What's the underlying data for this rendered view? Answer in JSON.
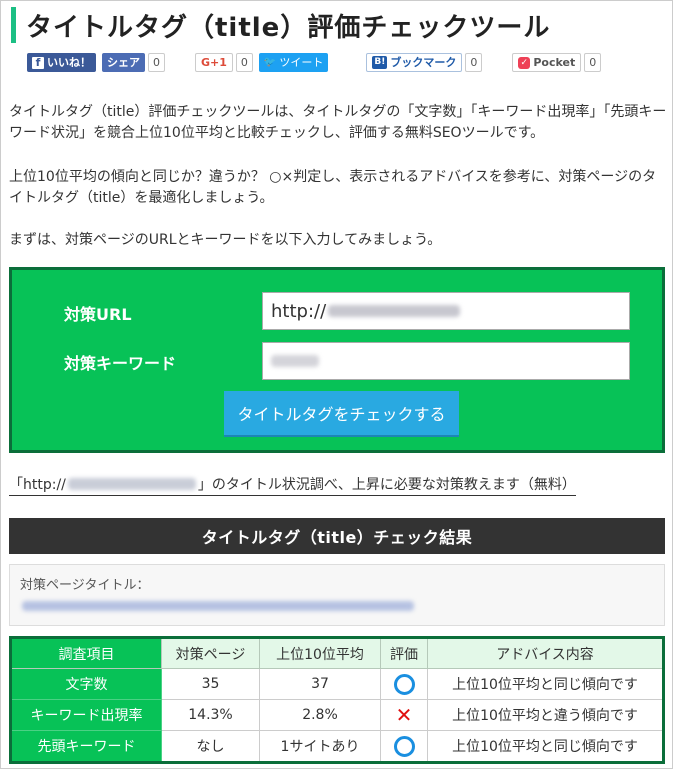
{
  "title": "タイトルタグ（title）評価チェックツール",
  "share": {
    "facebook_like": "いいね！",
    "facebook_share": "シェア",
    "facebook_count": "0",
    "google_plus": "G+1",
    "google_count": "0",
    "twitter": "ツイート",
    "hatena": "ブックマーク",
    "hatena_count": "0",
    "pocket": "Pocket",
    "pocket_count": "0"
  },
  "intro": {
    "p1": "タイトルタグ（title）評価チェックツールは、タイトルタグの「文字数」「キーワード出現率」「先頭キーワード状況」を競合上位10位平均と比較チェックし、評価する無料SEOツールです。",
    "p2": "上位10位平均の傾向と同じか？違うか？ ○×判定し、表示されるアドバイスを参考に、対策ページのタイトルタグ（title）を最適化しましょう。",
    "p3": "まずは、対策ページのURLとキーワードを以下入力してみましょう。"
  },
  "form": {
    "url_label": "対策URL",
    "url_value": "http://",
    "keyword_label": "対策キーワード",
    "submit_label": "タイトルタグをチェックする"
  },
  "link": {
    "prefix": "「http://",
    "suffix": "」のタイトル状況調べ、上昇に必要な対策教えます（無料）"
  },
  "result": {
    "heading": "タイトルタグ（title）チェック結果",
    "page_title_label": "対策ページタイトル："
  },
  "table": {
    "headers": [
      "調査項目",
      "対策ページ",
      "上位10位平均",
      "評価",
      "アドバイス内容"
    ],
    "rows": [
      {
        "item": "文字数",
        "page": "35",
        "avg": "37",
        "eval": "circle",
        "advice": "上位10位平均と同じ傾向です"
      },
      {
        "item": "キーワード出現率",
        "page": "14.3%",
        "avg": "2.8%",
        "eval": "cross",
        "advice": "上位10位平均と違う傾向です"
      },
      {
        "item": "先頭キーワード",
        "page": "なし",
        "avg": "1サイトあり",
        "eval": "circle",
        "advice": "上位10位平均と同じ傾向です"
      }
    ]
  },
  "colors": {
    "accent_green": "#07c257",
    "dark_green": "#0b6e3a",
    "button_blue": "#29a9e1",
    "circle_blue": "#1a8fe0",
    "cross_red": "#e01010"
  }
}
